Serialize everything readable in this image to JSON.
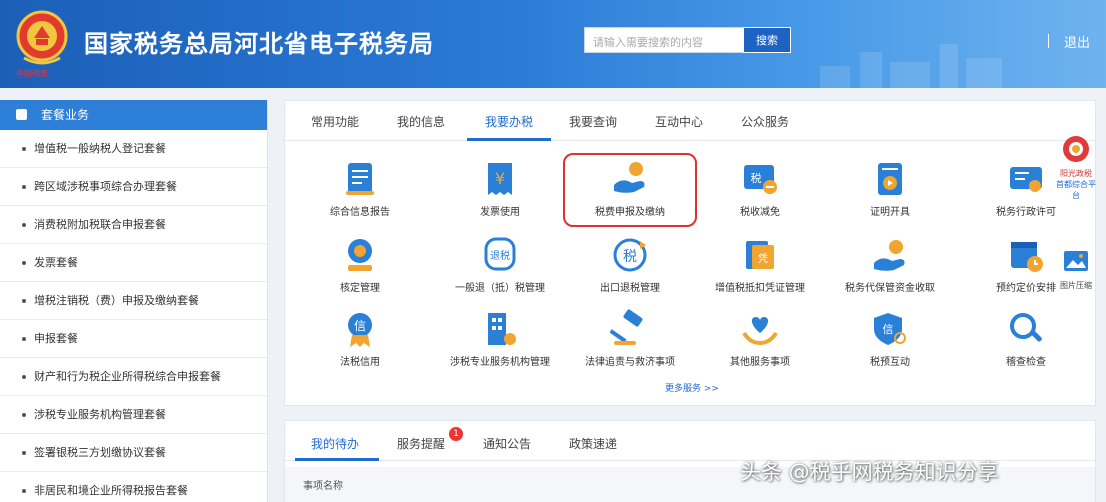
{
  "header": {
    "site_title": "国家税务总局河北省电子税务局",
    "search_placeholder": "请输入需要搜索的内容",
    "search_button": "搜索",
    "logout": "退出",
    "emblem_caption": "中国税务"
  },
  "sidebar": {
    "title": "套餐业务",
    "items": [
      "增值税一般纳税人登记套餐",
      "跨区域涉税事项综合办理套餐",
      "消费税附加税联合申报套餐",
      "发票套餐",
      "增税注销税（费）申报及缴纳套餐",
      "申报套餐",
      "财产和行为税企业所得税综合申报套餐",
      "涉税专业服务机构管理套餐",
      "签署银税三方划缴协议套餐",
      "非居民和境企业所得税报告套餐"
    ]
  },
  "main": {
    "tabs": [
      "常用功能",
      "我的信息",
      "我要办税",
      "我要查询",
      "互动中心",
      "公众服务"
    ],
    "active_tab": "我要办税",
    "functions": [
      {
        "label": "综合信息报告",
        "icon": "document-icon"
      },
      {
        "label": "发票使用",
        "icon": "invoice-icon"
      },
      {
        "label": "税费申报及缴纳",
        "icon": "hand-coin-icon"
      },
      {
        "label": "税收减免",
        "icon": "tax-discount-icon"
      },
      {
        "label": "证明开具",
        "icon": "certificate-icon"
      },
      {
        "label": "税务行政许可",
        "icon": "license-icon"
      },
      {
        "label": "核定管理",
        "icon": "stamp-icon"
      },
      {
        "label": "一般退（抵）税管理",
        "icon": "refund-icon"
      },
      {
        "label": "出口退税管理",
        "icon": "export-refund-icon"
      },
      {
        "label": "增值税抵扣凭证管理",
        "icon": "voucher-icon"
      },
      {
        "label": "税务代保管资金收取",
        "icon": "fund-icon"
      },
      {
        "label": "预约定价安排",
        "icon": "calendar-icon"
      },
      {
        "label": "法税信用",
        "icon": "credit-badge-icon"
      },
      {
        "label": "涉税专业服务机构管理",
        "icon": "building-icon"
      },
      {
        "label": "法律追责与救济事项",
        "icon": "gavel-icon"
      },
      {
        "label": "其他服务事项",
        "icon": "heart-hands-icon"
      },
      {
        "label": "税预互动",
        "icon": "shield-search-icon"
      },
      {
        "label": "稽查检查",
        "icon": "magnifier-icon"
      }
    ],
    "more_link": "更多服务 >>",
    "right_badge": {
      "title": "阳光政税",
      "subtitle": "首都综合平台"
    },
    "pic_badge": "图片压缩"
  },
  "lower": {
    "tabs": [
      "我的待办",
      "服务提醒",
      "通知公告",
      "政策速递"
    ],
    "active_tab": "我的待办",
    "reminder_count": "1",
    "column_header": "事项名称"
  },
  "watermark": "头条 @税乎网税务知识分享",
  "colors": {
    "header_blue": "#1b5fb8",
    "accent": "#1f6bd0",
    "highlight_red": "#e03030",
    "icon_blue": "#2a7fd6",
    "icon_orange": "#f0a530"
  }
}
